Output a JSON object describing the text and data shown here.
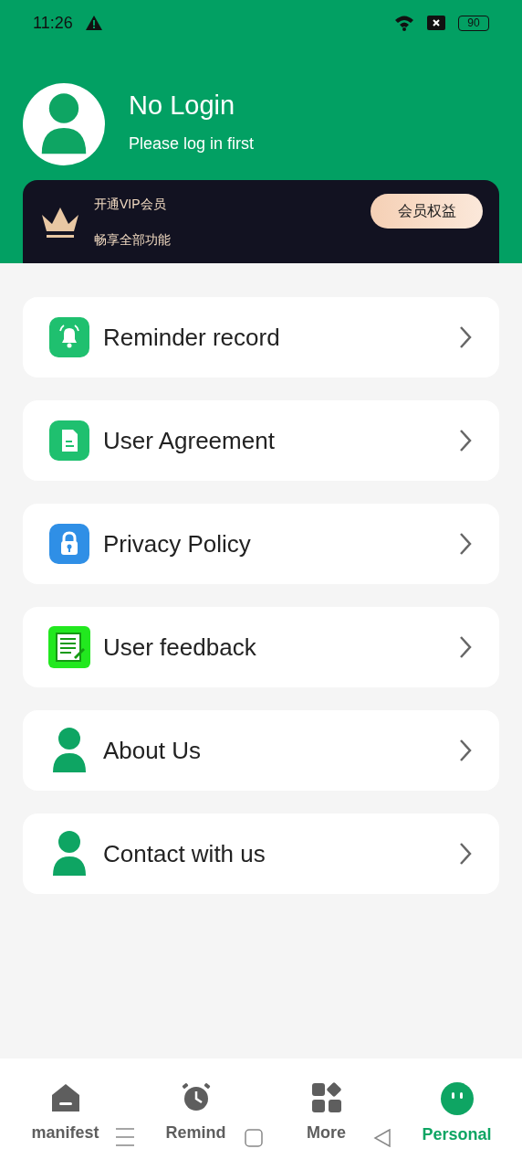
{
  "status_bar": {
    "time": "11:26",
    "battery": "90"
  },
  "profile": {
    "name": "No Login",
    "subtitle": "Please log in first"
  },
  "vip": {
    "title": "开通VIP会员",
    "subtitle": "畅享全部功能",
    "button": "会员权益"
  },
  "menu": [
    {
      "label": "Reminder record",
      "kind": "bell"
    },
    {
      "label": "User Agreement",
      "kind": "document"
    },
    {
      "label": "Privacy Policy",
      "kind": "lock"
    },
    {
      "label": "User feedback",
      "kind": "notepad"
    },
    {
      "label": "About Us",
      "kind": "person"
    },
    {
      "label": "Contact with us",
      "kind": "person"
    }
  ],
  "tabs": [
    {
      "label": "manifest",
      "kind": "home",
      "selected": false
    },
    {
      "label": "Remind",
      "kind": "alarm",
      "selected": false
    },
    {
      "label": "More",
      "kind": "grid",
      "selected": false
    },
    {
      "label": "Personal",
      "kind": "face",
      "selected": true
    }
  ]
}
